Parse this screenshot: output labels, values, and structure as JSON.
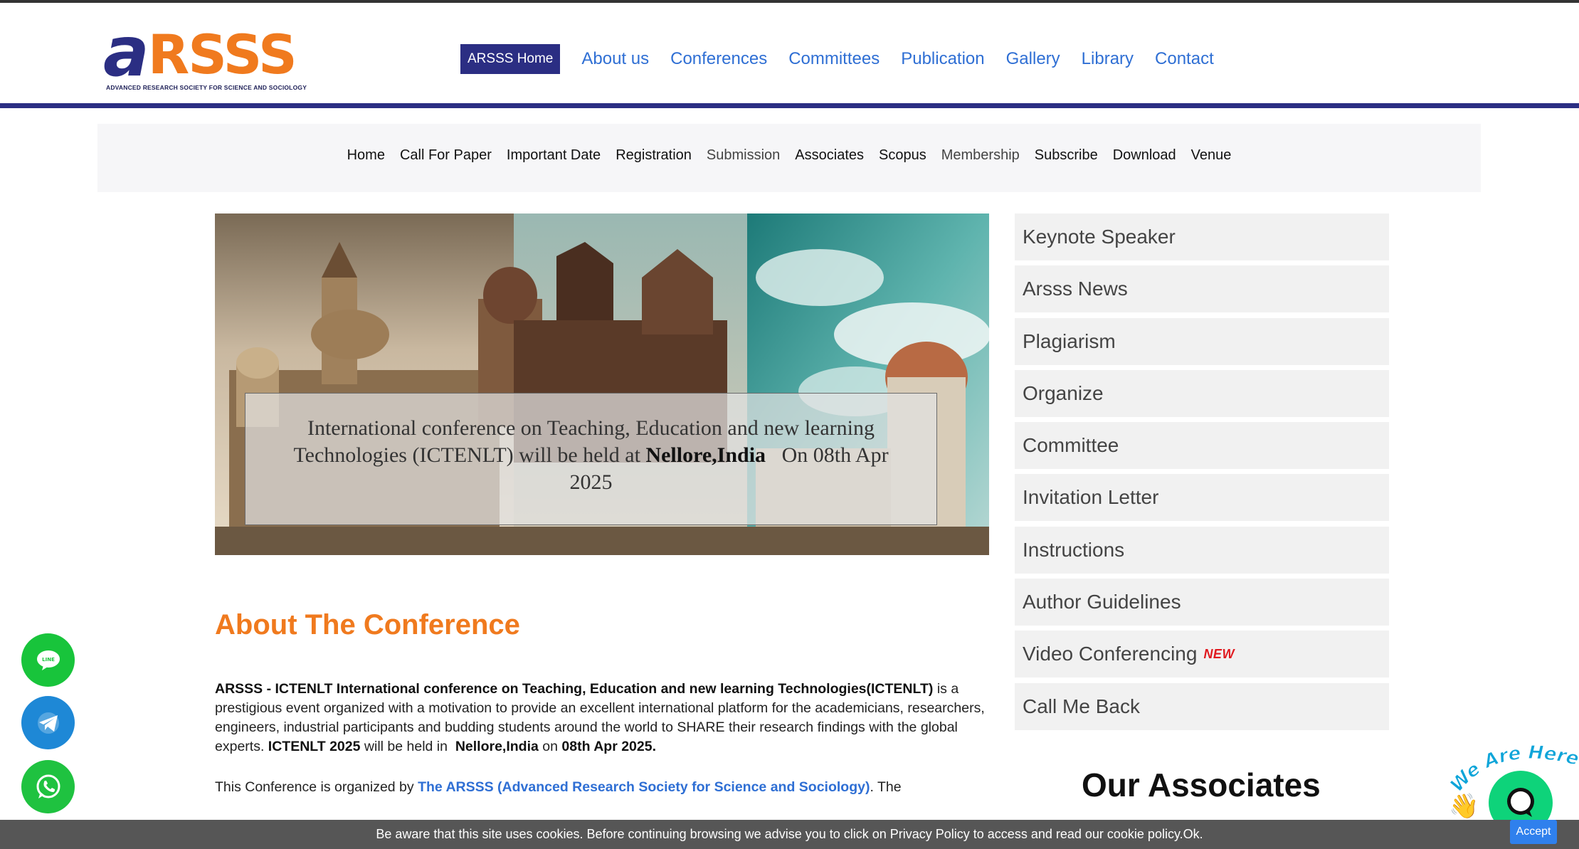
{
  "brand": {
    "logo_text_a": "a",
    "logo_text_rest": "RSSS",
    "logo_tagline": "ADVANCED RESEARCH SOCIETY FOR SCIENCE AND SOCIOLOGY",
    "primary_color": "#2b2e83",
    "accent_color": "#f07a1e",
    "link_color": "#2f6fd4"
  },
  "main_nav": {
    "home": "ARSSS Home",
    "links": [
      "About us",
      "Conferences",
      "Committees",
      "Publication",
      "Gallery",
      "Library",
      "Contact"
    ]
  },
  "sub_nav": [
    "Home",
    "Call For Paper",
    "Important Date",
    "Registration",
    "Submission",
    "Associates",
    "Scopus",
    "Membership",
    "Subscribe",
    "Download",
    "Venue"
  ],
  "hero": {
    "caption_lead": "International conference on Teaching, Education and new learning Technologies (ICTENLT) will be held at",
    "caption_location": "Nellore,India",
    "caption_date": "On 08th Apr 2025"
  },
  "about": {
    "title": "About The Conference",
    "p1_bold": "ARSSS - ICTENLT International conference on Teaching, Education and new learning Technologies(ICTENLT)",
    "p1_text": "is a prestigious event organized with a motivation to provide an excellent international platform for the academicians, researchers, engineers, industrial participants and budding students around the world to SHARE their research findings with the global experts.",
    "p1_bold2": "ICTENLT 2025",
    "p1_text2": "will be held in",
    "p1_location": "Nellore,India",
    "p1_text3": "on",
    "p1_date": "08th Apr 2025.",
    "p2_text": "This Conference is organized by",
    "p2_link": "The ARSSS (Advanced Research Society for Science and Sociology)",
    "p2_tail": ". The"
  },
  "side_menu": {
    "items": [
      "Keynote Speaker",
      "Arsss News",
      "Plagiarism",
      "Organize",
      "Committee",
      "Invitation Letter",
      "Instructions",
      "Author Guidelines",
      "Video Conferencing",
      "Call Me Back"
    ],
    "new_badge": "NEW"
  },
  "associates_title": "Our Associates",
  "floating": {
    "line_label": "LINE",
    "icons": [
      "line-icon",
      "telegram-icon",
      "whatsapp-icon"
    ]
  },
  "chat_widget": {
    "label": "We Are Here!",
    "icons": [
      "wave-hand-icon",
      "chat-bubble-icon"
    ]
  },
  "cookie": {
    "text": "Be aware that this site uses cookies. Before continuing browsing we advise you to click on Privacy Policy to access and read our cookie policy.Ok.",
    "accept": "Accept"
  }
}
